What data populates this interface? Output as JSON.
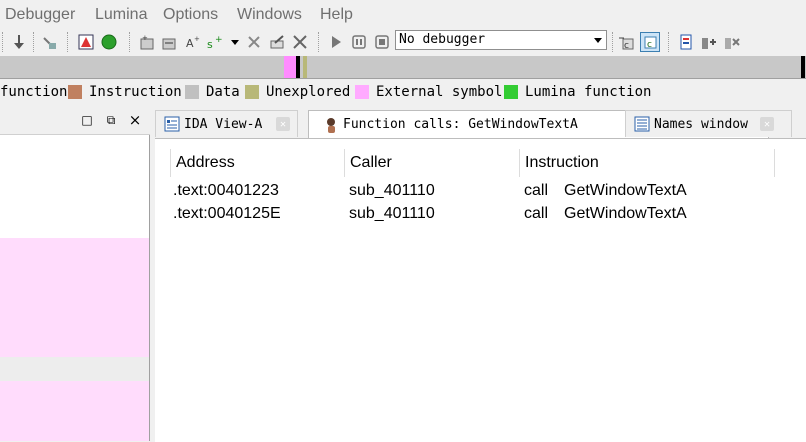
{
  "menu": [
    "Debugger",
    "Lumina",
    "Options",
    "Windows",
    "Help"
  ],
  "toolbar": {
    "debugger_select_value": "No debugger"
  },
  "legend": [
    {
      "label": "function",
      "color": ""
    },
    {
      "label": "Instruction",
      "color": "#c08060"
    },
    {
      "label": "Data",
      "color": "#c0c0c0"
    },
    {
      "label": "Unexplored",
      "color": "#b8b878"
    },
    {
      "label": "External symbol",
      "color": "#ffaaff"
    },
    {
      "label": "Lumina function",
      "color": "#33cc33"
    }
  ],
  "left_panel": {
    "maximize_glyph": "□",
    "restore_glyph": "⧉",
    "close_glyph": "×"
  },
  "tabs": [
    {
      "label": "IDA View-A",
      "active": false,
      "icon": "disassembly-icon"
    },
    {
      "label": "Function calls: GetWindowTextA",
      "active": true,
      "icon": "person-icon"
    },
    {
      "label": "Names window",
      "active": false,
      "icon": "names-icon"
    }
  ],
  "table": {
    "columns": [
      "Address",
      "Caller",
      "Instruction"
    ],
    "rows": [
      {
        "address": ".text:00401223",
        "caller": "sub_401110",
        "mnemonic": "call",
        "operand": "GetWindowTextA"
      },
      {
        "address": ".text:0040125E",
        "caller": "sub_401110",
        "mnemonic": "call",
        "operand": "GetWindowTextA"
      }
    ]
  },
  "colors": {
    "pink_region": "#ffdcfc",
    "active_close": "#e0463c"
  }
}
